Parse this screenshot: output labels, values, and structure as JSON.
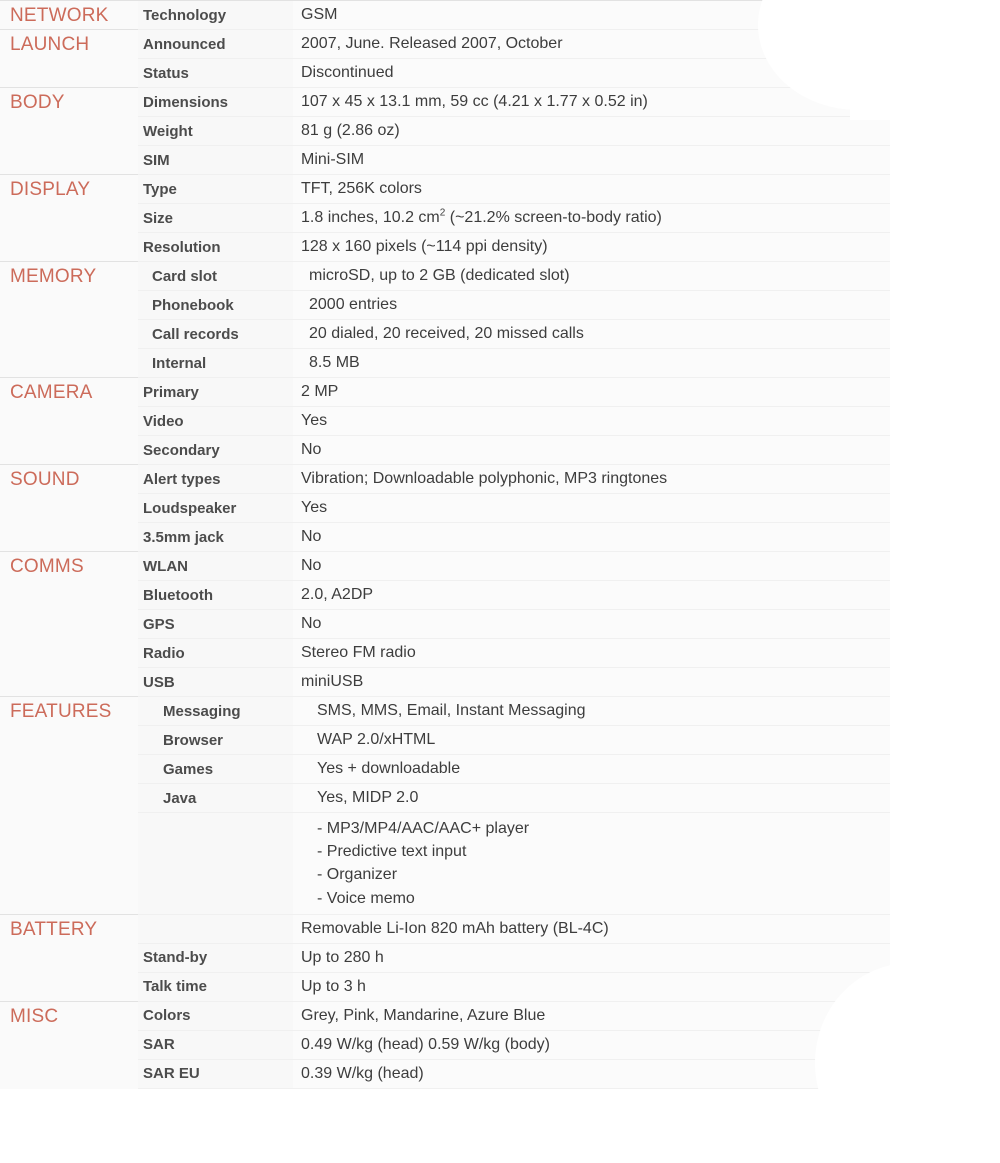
{
  "page": {
    "title": "Phone specifications table",
    "accent_color": "#cc6b5a",
    "key_color": "#4c4c4c",
    "value_color": "#3d3d3d",
    "background": "#fafafa"
  },
  "sections": [
    {
      "name": "NETWORK",
      "rows": [
        {
          "key": "Technology",
          "value": "GSM"
        }
      ]
    },
    {
      "name": "LAUNCH",
      "rows": [
        {
          "key": "Announced",
          "value": "2007, June. Released 2007, October"
        },
        {
          "key": "Status",
          "value": "Discontinued"
        }
      ]
    },
    {
      "name": "BODY",
      "rows": [
        {
          "key": "Dimensions",
          "value": "107 x 45 x 13.1 mm, 59 cc (4.21 x 1.77 x 0.52 in)"
        },
        {
          "key": "Weight",
          "value": "81 g (2.86 oz)"
        },
        {
          "key": "SIM",
          "value": "Mini-SIM"
        }
      ]
    },
    {
      "name": "DISPLAY",
      "rows": [
        {
          "key": "Type",
          "value": "TFT, 256K colors"
        },
        {
          "key": "Size",
          "value_prefix": "1.8 inches, 10.2 cm",
          "value_sup": "2",
          "value_suffix": " (~21.2% screen-to-body ratio)"
        },
        {
          "key": "Resolution",
          "value": "128 x 160 pixels (~114 ppi density)"
        }
      ]
    },
    {
      "name": "MEMORY",
      "rows": [
        {
          "key": "Card slot",
          "value": "microSD, up to 2 GB (dedicated slot)"
        },
        {
          "key": "Phonebook",
          "value": "2000 entries"
        },
        {
          "key": "Call records",
          "value": "20 dialed, 20 received, 20 missed calls"
        },
        {
          "key": "Internal",
          "value": "8.5 MB"
        }
      ]
    },
    {
      "name": "CAMERA",
      "rows": [
        {
          "key": "Primary",
          "value": "2 MP"
        },
        {
          "key": "Video",
          "value": "Yes"
        },
        {
          "key": "Secondary",
          "value": "No"
        }
      ]
    },
    {
      "name": "SOUND",
      "rows": [
        {
          "key": "Alert types",
          "value": "Vibration; Downloadable polyphonic, MP3 ringtones"
        },
        {
          "key": "Loudspeaker",
          "value": "Yes"
        },
        {
          "key": "3.5mm jack",
          "value": "No"
        }
      ]
    },
    {
      "name": "COMMS",
      "rows": [
        {
          "key": "WLAN",
          "value": "No"
        },
        {
          "key": "Bluetooth",
          "value": "2.0, A2DP"
        },
        {
          "key": "GPS",
          "value": "No"
        },
        {
          "key": "Radio",
          "value": "Stereo FM radio"
        },
        {
          "key": "USB",
          "value": "miniUSB"
        }
      ]
    },
    {
      "name": "FEATURES",
      "rows": [
        {
          "key": "Messaging",
          "value": "SMS, MMS, Email, Instant Messaging"
        },
        {
          "key": "Browser",
          "value": "WAP 2.0/xHTML"
        },
        {
          "key": "Games",
          "value": "Yes + downloadable"
        },
        {
          "key": "Java",
          "value": "Yes, MIDP 2.0"
        },
        {
          "key": "",
          "value": "- MP3/MP4/AAC/AAC+ player\n- Predictive text input\n- Organizer\n- Voice memo"
        }
      ]
    },
    {
      "name": "BATTERY",
      "rows": [
        {
          "key": "",
          "value": "Removable Li-Ion 820 mAh battery (BL-4C)"
        },
        {
          "key": "Stand-by",
          "value": "Up to 280 h"
        },
        {
          "key": "Talk time",
          "value": "Up to 3 h"
        }
      ]
    },
    {
      "name": "MISC",
      "rows": [
        {
          "key": "Colors",
          "value": "Grey, Pink, Mandarine, Azure Blue"
        },
        {
          "key": "SAR",
          "value": "0.49 W/kg (head)      0.59 W/kg (body)"
        },
        {
          "key": "SAR EU",
          "value": "0.39 W/kg (head)"
        }
      ]
    }
  ]
}
